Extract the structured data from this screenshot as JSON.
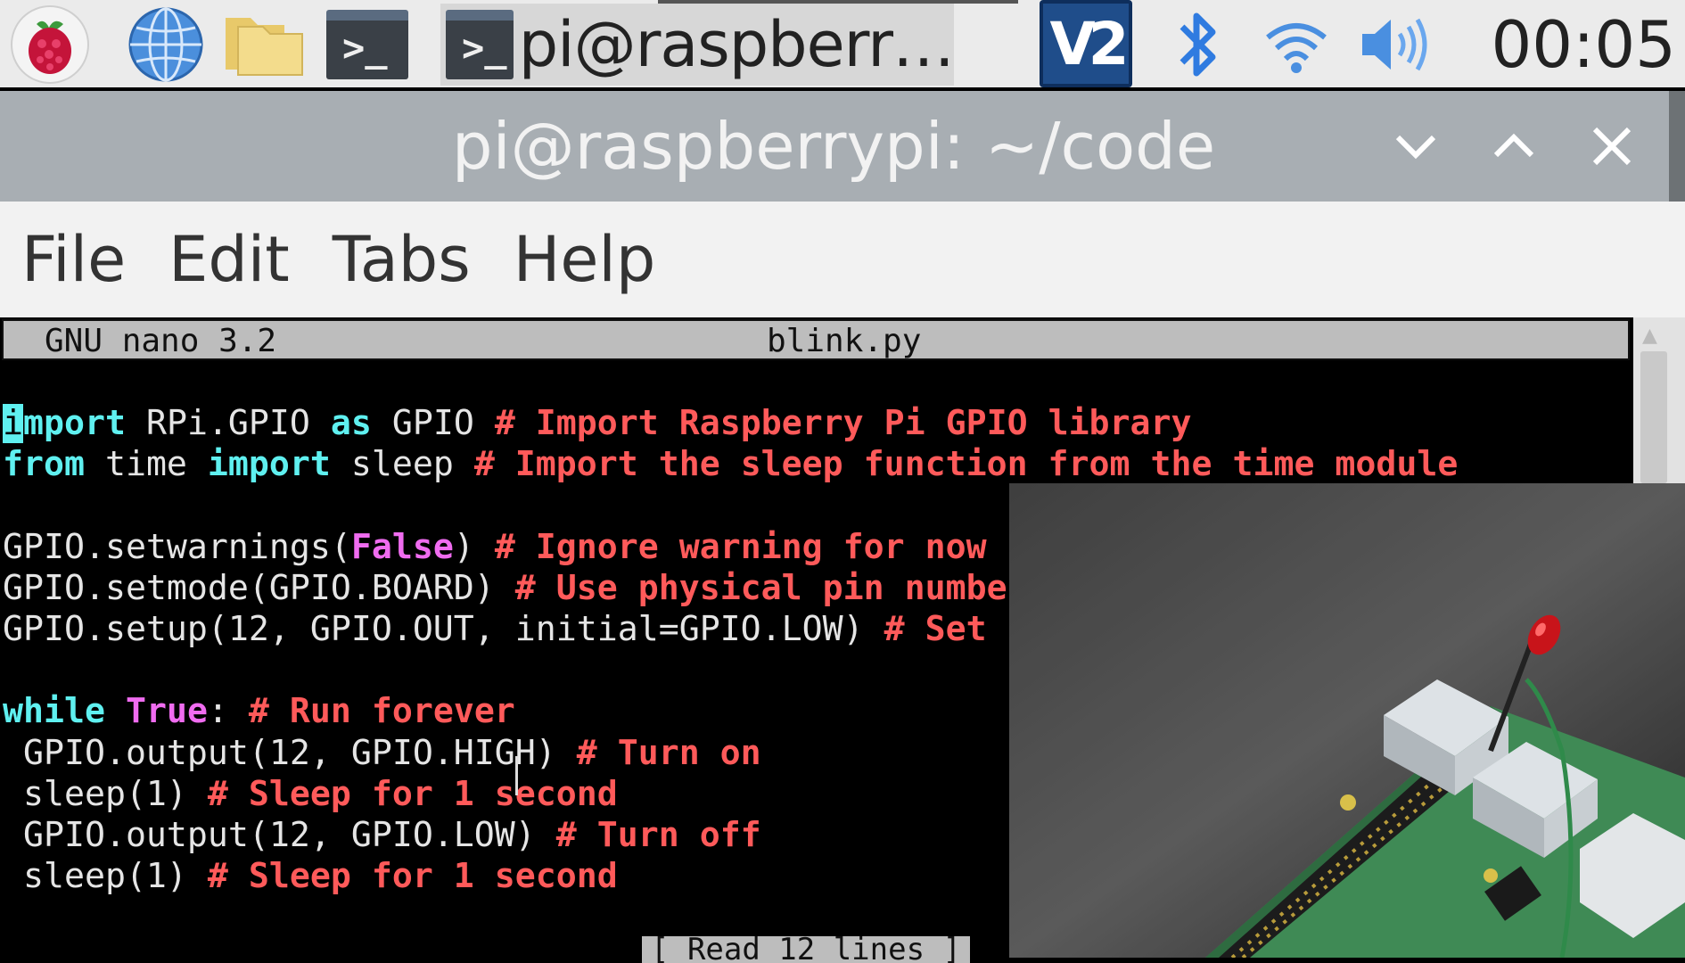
{
  "taskbar": {
    "launchers": [
      "raspberry-menu-icon",
      "web-browser-icon",
      "file-manager-icon",
      "terminal-icon"
    ],
    "task_button_label": "pi@raspberr…",
    "tray_icons": [
      "vnc-icon",
      "bluetooth-icon",
      "wifi-icon",
      "volume-icon"
    ],
    "clock": "00:05",
    "vnc_label": "V2"
  },
  "window": {
    "title": "pi@raspberrypi: ~/code",
    "controls": [
      "minimize",
      "maximize",
      "close"
    ]
  },
  "menubar": {
    "items": [
      "File",
      "Edit",
      "Tabs",
      "Help"
    ]
  },
  "nano": {
    "version": "GNU nano 3.2",
    "filename": "blink.py",
    "status": "[ Read 12 lines ]"
  },
  "code": {
    "lines": [
      [
        {
          "t": "i",
          "c": "cursor"
        },
        {
          "t": "mport",
          "c": "kw"
        },
        {
          "t": " RPi.GPIO ",
          "c": "tx"
        },
        {
          "t": "as",
          "c": "kw"
        },
        {
          "t": " GPIO ",
          "c": "tx"
        },
        {
          "t": "# Import Raspberry Pi GPIO library",
          "c": "cm"
        }
      ],
      [
        {
          "t": "from",
          "c": "kw"
        },
        {
          "t": " time ",
          "c": "tx"
        },
        {
          "t": "import",
          "c": "kw"
        },
        {
          "t": " sleep ",
          "c": "tx"
        },
        {
          "t": "# Import the sleep function from the time module",
          "c": "cm"
        }
      ],
      [],
      [
        {
          "t": "GPIO.setwarnings(",
          "c": "tx"
        },
        {
          "t": "False",
          "c": "bo"
        },
        {
          "t": ") ",
          "c": "tx"
        },
        {
          "t": "# Ignore warning for now",
          "c": "cm"
        }
      ],
      [
        {
          "t": "GPIO.setmode(GPIO.BOARD) ",
          "c": "tx"
        },
        {
          "t": "# Use physical pin numbe",
          "c": "cm"
        }
      ],
      [
        {
          "t": "GPIO.setup(12, GPIO.OUT, initial=GPIO.LOW) ",
          "c": "tx"
        },
        {
          "t": "# Set",
          "c": "cm"
        }
      ],
      [],
      [
        {
          "t": "while",
          "c": "kw"
        },
        {
          "t": " ",
          "c": "tx"
        },
        {
          "t": "True",
          "c": "bo"
        },
        {
          "t": ": ",
          "c": "tx"
        },
        {
          "t": "# Run forever",
          "c": "cm"
        }
      ],
      [
        {
          "t": " GPIO.output(12, GPIO.HIGH) ",
          "c": "tx"
        },
        {
          "t": "# Turn on",
          "c": "cm"
        }
      ],
      [
        {
          "t": " sleep(1) ",
          "c": "tx"
        },
        {
          "t": "# Sleep for 1 second",
          "c": "cm"
        }
      ],
      [
        {
          "t": " GPIO.output(12, GPIO.LOW) ",
          "c": "tx"
        },
        {
          "t": "# Turn off",
          "c": "cm"
        }
      ],
      [
        {
          "t": " sleep(1) ",
          "c": "tx"
        },
        {
          "t": "# Sleep for 1 second",
          "c": "cm"
        }
      ]
    ]
  },
  "overlay": {
    "subject": "raspberry-pi-board-with-red-led",
    "colors": {
      "board": "#3f8a55",
      "led": "#c8141a",
      "usb": "#d8dde0"
    }
  },
  "colors": {
    "panel": "#ebebeb",
    "titlebar": "#a8aeb3",
    "keyword": "#5ff0f0",
    "comment": "#ff5a5a",
    "boolean": "#f06cf0",
    "text": "#e5e5e5"
  }
}
